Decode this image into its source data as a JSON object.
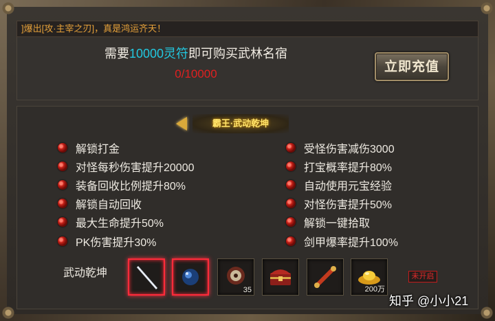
{
  "ticker": {
    "text": "]爆出[攻·主宰之刃]，真是鸿运齐天！"
  },
  "purchase": {
    "need_prefix": "需要",
    "need_amount": "10000灵符",
    "need_suffix": "即可购买武林名宿",
    "progress": "0/10000",
    "recharge_label": "立即充值"
  },
  "section_title": "霸王·武动乾坤",
  "perks_left": [
    {
      "label": "解锁打金"
    },
    {
      "label": "对怪每秒伤害提升20000"
    },
    {
      "label": "装备回收比例提升80%"
    },
    {
      "label": "解锁自动回收"
    },
    {
      "label": "最大生命提升50%"
    },
    {
      "label": "PK伤害提升30%"
    }
  ],
  "perks_right": [
    {
      "label": "受怪伤害减伤3000"
    },
    {
      "label": "打宝概率提升80%"
    },
    {
      "label": "自动使用元宝经验"
    },
    {
      "label": "对怪伤害提升50%"
    },
    {
      "label": "解锁一键拾取"
    },
    {
      "label": "剑甲爆率提升100%"
    }
  ],
  "rewards": {
    "label": "武动乾坤",
    "items": [
      {
        "icon": "sword-icon",
        "qty": ""
      },
      {
        "icon": "blue-orb-icon",
        "qty": ""
      },
      {
        "icon": "disc-icon",
        "qty": "35"
      },
      {
        "icon": "treasure-chest-icon",
        "qty": ""
      },
      {
        "icon": "scroll-icon",
        "qty": ""
      },
      {
        "icon": "gold-ingot-icon",
        "qty": "200万"
      }
    ],
    "status": "未开启"
  },
  "watermark": "知乎 @小小21",
  "colors": {
    "accent_cyan": "#22c8e0",
    "progress_red": "#e02020",
    "ticker_orange": "#e7a23a",
    "title_gold": "#ffe46a"
  }
}
